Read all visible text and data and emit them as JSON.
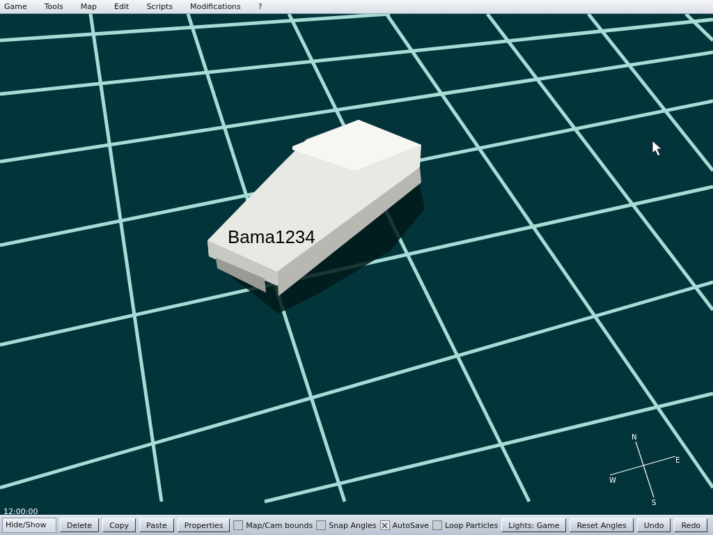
{
  "menu_bar": {
    "items": [
      "Game",
      "Tools",
      "Map",
      "Edit",
      "Scripts",
      "Modifications",
      "?"
    ]
  },
  "viewport": {
    "object_label": "Bama1234",
    "time": "12:00:00",
    "compass": {
      "north": "N",
      "south": "S",
      "east": "E",
      "west": "W"
    }
  },
  "toolbar": {
    "items": [
      {
        "kind": "field",
        "label": "Hide/Show"
      },
      {
        "kind": "button",
        "label": "Delete"
      },
      {
        "kind": "button",
        "label": "Copy"
      },
      {
        "kind": "button",
        "label": "Paste"
      },
      {
        "kind": "button",
        "label": "Properties"
      },
      {
        "kind": "checkbox",
        "label": "Map/Cam bounds",
        "checked": false
      },
      {
        "kind": "checkbox",
        "label": "Snap Angles",
        "checked": false
      },
      {
        "kind": "checkbox",
        "label": "AutoSave",
        "checked": true
      },
      {
        "kind": "checkbox",
        "label": "Loop Particles",
        "checked": false
      },
      {
        "kind": "button",
        "label": "Lights: Game"
      },
      {
        "kind": "button",
        "label": "Reset Angles"
      },
      {
        "kind": "button",
        "label": "Undo"
      },
      {
        "kind": "button",
        "label": "Redo"
      }
    ]
  }
}
